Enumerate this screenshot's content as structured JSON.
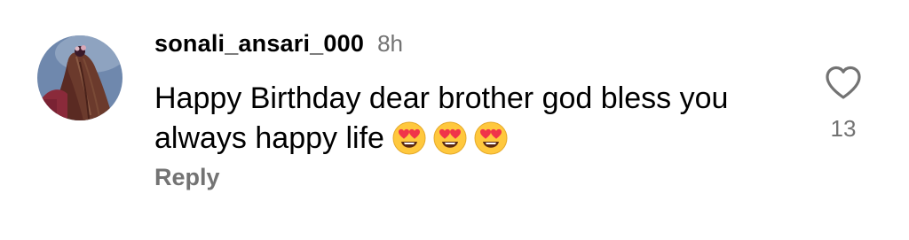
{
  "comment": {
    "username": "sonali_ansari_000",
    "timestamp": "8h",
    "text": "Happy Birthday dear brother  god bless you always happy life",
    "emojis": [
      {
        "icon": "heart-eyes-emoji"
      },
      {
        "icon": "heart-eyes-emoji"
      },
      {
        "icon": "heart-eyes-emoji"
      }
    ],
    "reply_label": "Reply",
    "like_count": "13",
    "like_icon": "heart-outline-icon"
  },
  "colors": {
    "text_primary": "#000000",
    "text_secondary": "#737373",
    "background": "#ffffff",
    "emoji_face": "#FFC83D",
    "emoji_heart": "#F0344A"
  }
}
